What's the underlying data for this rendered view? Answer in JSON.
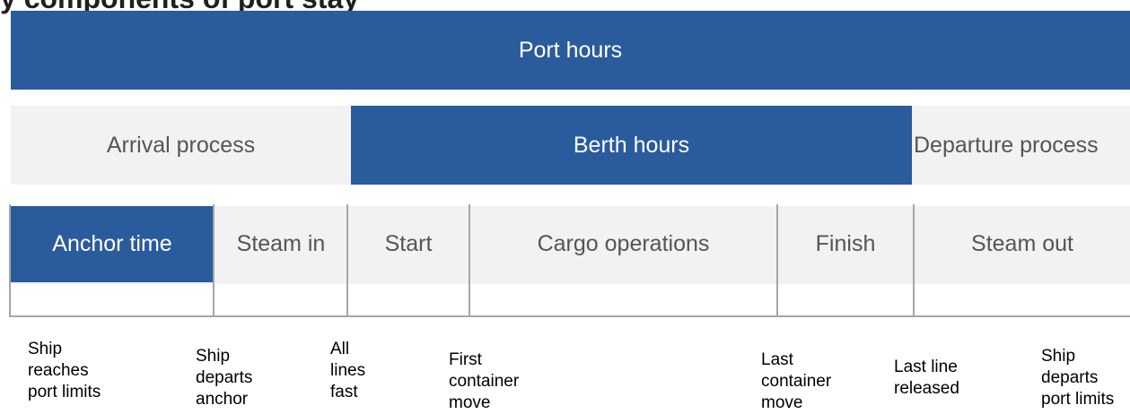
{
  "header": {
    "title": "y components of port stay"
  },
  "bands": {
    "port_hours": "Port hours",
    "arrival": "Arrival process",
    "berth": "Berth hours",
    "departure": "Departure process"
  },
  "phases": {
    "anchor": "Anchor time",
    "steam_in": "Steam in",
    "start": "Start",
    "cargo": "Cargo operations",
    "finish": "Finish",
    "steam_out": "Steam out"
  },
  "events": {
    "e1": [
      "Ship",
      "reaches",
      "port limits"
    ],
    "e2": [
      "Ship",
      "departs",
      "anchor"
    ],
    "e3": [
      "All",
      "lines",
      "fast"
    ],
    "e4": [
      "First",
      "container",
      "move"
    ],
    "e5": [
      "Last",
      "container",
      "move"
    ],
    "e6": [
      "Last line",
      "released"
    ],
    "e7": [
      "Ship",
      "departs",
      "port limits"
    ]
  }
}
